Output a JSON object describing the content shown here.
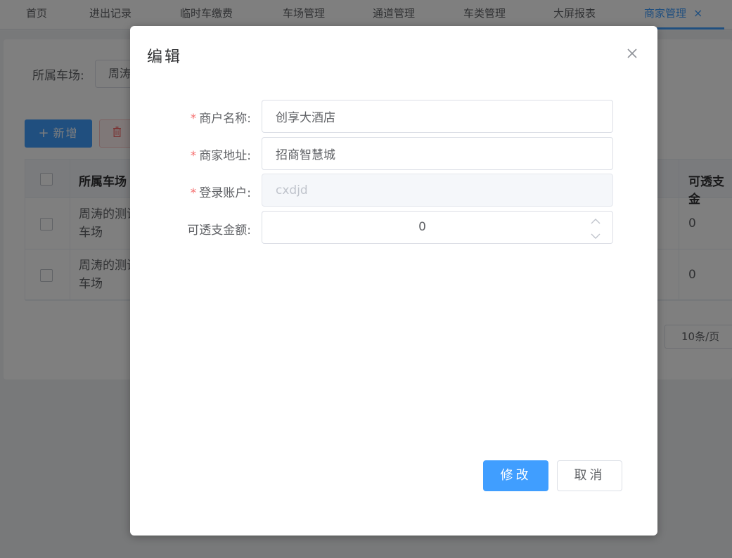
{
  "tabs": [
    {
      "label": "首页",
      "active": false
    },
    {
      "label": "进出记录",
      "active": false
    },
    {
      "label": "临时车缴费",
      "active": false
    },
    {
      "label": "车场管理",
      "active": false
    },
    {
      "label": "通道管理",
      "active": false
    },
    {
      "label": "车类管理",
      "active": false
    },
    {
      "label": "大屏报表",
      "active": false
    },
    {
      "label": "商家管理",
      "active": true,
      "close_icon": "close-icon"
    }
  ],
  "tab_close_glyph": "×",
  "filter": {
    "label": "所属车场:",
    "value": "周涛"
  },
  "toolbar": {
    "add_icon": "plus-icon",
    "add_label": "新增",
    "delete_icon": "trash-icon"
  },
  "table": {
    "headers": {
      "parking_lot": "所属车场",
      "transferable_amount": "可透支金"
    },
    "rows": [
      {
        "parking_lot_line1": "周涛的测试",
        "parking_lot_line2": "车场",
        "amount": "0"
      },
      {
        "parking_lot_line1": "周涛的测试",
        "parking_lot_line2": "车场",
        "amount": "0"
      }
    ]
  },
  "pagination": {
    "page_size": "10条/页"
  },
  "dialog": {
    "title": "编辑",
    "close_icon": "close-icon",
    "required_mark": "*",
    "fields": {
      "merchant_name": {
        "label": "商户名称:",
        "value": "创享大酒店",
        "required": true
      },
      "merchant_address": {
        "label": "商家地址:",
        "value": "招商智慧城",
        "required": true
      },
      "login_account": {
        "label": "登录账户:",
        "value": "cxdjd",
        "required": true,
        "disabled": true
      },
      "overdraft_amount": {
        "label": "可透支金额:",
        "value": "0",
        "required": false
      }
    },
    "buttons": {
      "submit": "修改",
      "cancel": "取消"
    }
  },
  "colors": {
    "primary": "#409eff",
    "danger": "#f56c6c",
    "overlay": "rgba(0,0,0,0.5)"
  }
}
